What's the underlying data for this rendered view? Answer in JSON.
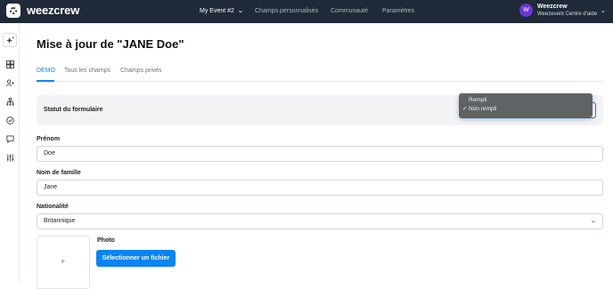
{
  "topbar": {
    "brand": "weezcrew",
    "nav": [
      {
        "label": "My Event #2",
        "active": true
      },
      {
        "label": "Champs personnalisés",
        "active": false
      },
      {
        "label": "Communauté",
        "active": false
      },
      {
        "label": "Paramètres",
        "active": false
      }
    ],
    "user": {
      "initial": "W",
      "name": "Weezcrew",
      "subtitle": "Weezevent Centre d'aide"
    }
  },
  "rail": {
    "icons": [
      "sparkle-icon",
      "dashboard-icon",
      "users-icon",
      "org-chart-icon",
      "check-circle-icon",
      "chat-icon",
      "sliders-icon"
    ]
  },
  "page": {
    "title": "Mise à jour de \"JANE Doe\"",
    "tabs": [
      {
        "label": "DEMO",
        "active": true
      },
      {
        "label": "Tous les champs",
        "active": false
      },
      {
        "label": "Champs privés",
        "active": false
      }
    ]
  },
  "form": {
    "status": {
      "label": "Statut du formulaire",
      "options": [
        {
          "label": "Rempli",
          "selected": false
        },
        {
          "label": "Non rempli",
          "selected": true
        }
      ],
      "check_mark": "✓"
    },
    "first_name": {
      "label": "Prénom",
      "value": "Doe"
    },
    "last_name": {
      "label": "Nom de famille",
      "value": "Jane"
    },
    "nationality": {
      "label": "Nationalité",
      "value": "Britannique"
    },
    "photo": {
      "label": "Photo",
      "button": "Sélectionner un fichier",
      "placeholder": "+"
    }
  },
  "colors": {
    "accent": "#0b84f3",
    "topbar": "#1f2937",
    "avatar": "#6b35d6",
    "dropdown": "#5f6366"
  }
}
